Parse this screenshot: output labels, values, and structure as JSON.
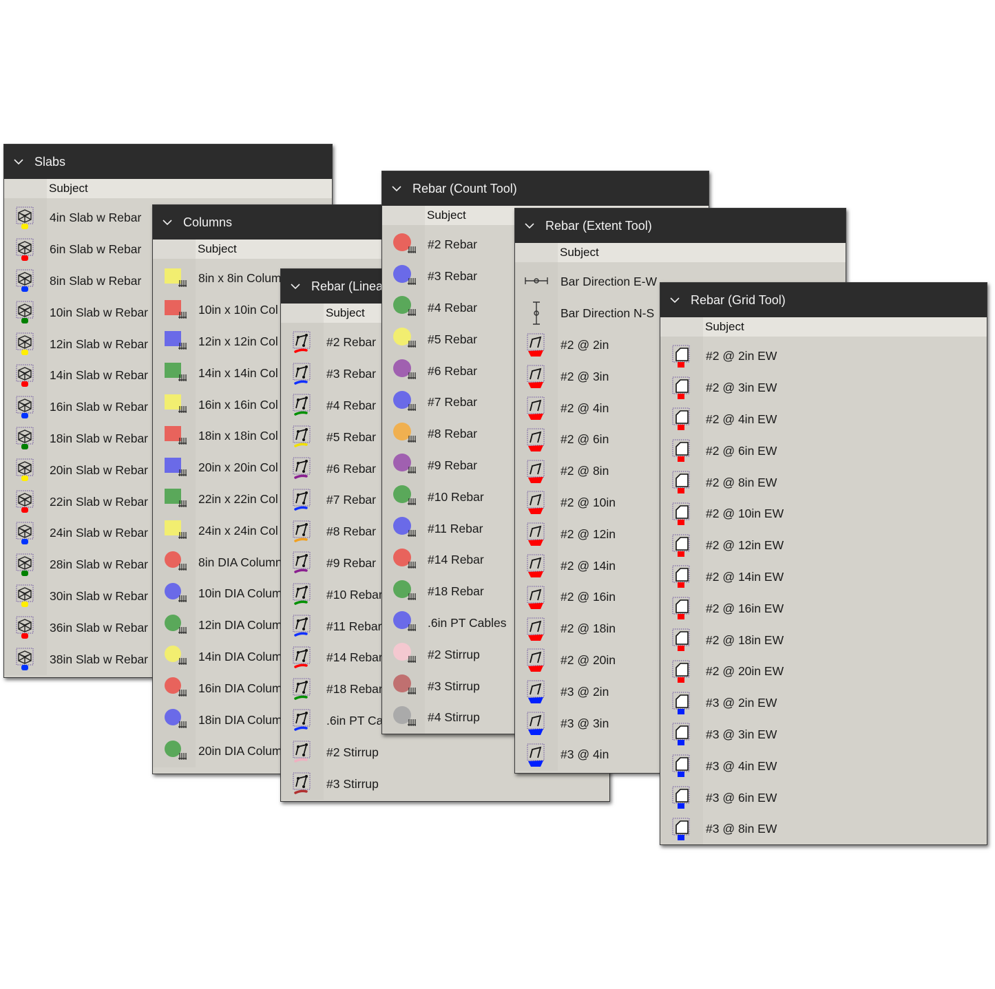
{
  "column_header": "Subject",
  "panels": {
    "slabs": {
      "title": "Slabs",
      "items": [
        {
          "label": "4in Slab w Rebar",
          "color": "#ffee00"
        },
        {
          "label": "6in Slab w Rebar",
          "color": "#ff0000"
        },
        {
          "label": "8in Slab w Rebar",
          "color": "#0033ff"
        },
        {
          "label": "10in Slab w Rebar",
          "color": "#008000"
        },
        {
          "label": "12in Slab w Rebar",
          "color": "#ffee00"
        },
        {
          "label": "14in Slab w Rebar",
          "color": "#ff0000"
        },
        {
          "label": "16in Slab w Rebar",
          "color": "#0033ff"
        },
        {
          "label": "18in Slab w Rebar",
          "color": "#008000"
        },
        {
          "label": "20in Slab w Rebar",
          "color": "#ffee00"
        },
        {
          "label": "22in Slab w Rebar",
          "color": "#ff0000"
        },
        {
          "label": "24in Slab w Rebar",
          "color": "#0033ff"
        },
        {
          "label": "28in Slab w Rebar",
          "color": "#008000"
        },
        {
          "label": "30in Slab w Rebar",
          "color": "#ffee00"
        },
        {
          "label": "36in Slab w Rebar",
          "color": "#ff0000"
        },
        {
          "label": "38in Slab w Rebar",
          "color": "#0033ff"
        }
      ]
    },
    "columns": {
      "title": "Columns",
      "items": [
        {
          "label": "8in x 8in Colum",
          "color": "#f2ee70",
          "shape": "square"
        },
        {
          "label": "10in x 10in Col",
          "color": "#e8635c",
          "shape": "square"
        },
        {
          "label": "12in x 12in Col",
          "color": "#6a6ae8",
          "shape": "square"
        },
        {
          "label": "14in x 14in Col",
          "color": "#5aa85a",
          "shape": "square"
        },
        {
          "label": "16in x 16in Col",
          "color": "#f2ee70",
          "shape": "square"
        },
        {
          "label": "18in x 18in Col",
          "color": "#e8635c",
          "shape": "square"
        },
        {
          "label": "20in x 20in Col",
          "color": "#6a6ae8",
          "shape": "square"
        },
        {
          "label": "22in x 22in Col",
          "color": "#5aa85a",
          "shape": "square"
        },
        {
          "label": "24in x 24in Col",
          "color": "#f2ee70",
          "shape": "square"
        },
        {
          "label": "8in DIA Column",
          "color": "#e8635c",
          "shape": "circle"
        },
        {
          "label": "10in DIA Colum",
          "color": "#6a6ae8",
          "shape": "circle"
        },
        {
          "label": "12in DIA Colum",
          "color": "#5aa85a",
          "shape": "circle"
        },
        {
          "label": "14in DIA Colum",
          "color": "#f2ee70",
          "shape": "circle"
        },
        {
          "label": "16in DIA Colum",
          "color": "#e8635c",
          "shape": "circle"
        },
        {
          "label": "18in DIA Colum",
          "color": "#6a6ae8",
          "shape": "circle"
        },
        {
          "label": "20in DIA Colum",
          "color": "#5aa85a",
          "shape": "circle"
        }
      ]
    },
    "rebar_linear": {
      "title": "Rebar (Linear",
      "items": [
        {
          "label": "#2 Rebar",
          "color": "#ff0000"
        },
        {
          "label": "#3 Rebar",
          "color": "#1030ff"
        },
        {
          "label": "#4 Rebar",
          "color": "#009000"
        },
        {
          "label": "#5 Rebar",
          "color": "#f0e000"
        },
        {
          "label": "#6 Rebar",
          "color": "#8a2090"
        },
        {
          "label": "#7 Rebar",
          "color": "#1030ff"
        },
        {
          "label": "#8 Rebar",
          "color": "#f0a020"
        },
        {
          "label": "#9 Rebar",
          "color": "#8a2090"
        },
        {
          "label": "#10 Rebar",
          "color": "#009000"
        },
        {
          "label": "#11 Rebar",
          "color": "#1030ff"
        },
        {
          "label": "#14 Rebar",
          "color": "#ff0000"
        },
        {
          "label": "#18 Rebar",
          "color": "#009000"
        },
        {
          "label": ".6in PT Ca",
          "color": "#1030ff"
        },
        {
          "label": "#2 Stirrup",
          "color": "#f0b0c0"
        },
        {
          "label": "#3 Stirrup",
          "color": "#b03030"
        }
      ]
    },
    "rebar_count": {
      "title": "Rebar (Count Tool)",
      "items": [
        {
          "label": "#2 Rebar",
          "color": "#e8635c"
        },
        {
          "label": "#3 Rebar",
          "color": "#6a6ae8"
        },
        {
          "label": "#4 Rebar",
          "color": "#5aa85a"
        },
        {
          "label": "#5 Rebar",
          "color": "#f2ee70"
        },
        {
          "label": "#6 Rebar",
          "color": "#a060b0"
        },
        {
          "label": "#7 Rebar",
          "color": "#6a6ae8"
        },
        {
          "label": "#8 Rebar",
          "color": "#f0b050"
        },
        {
          "label": "#9 Rebar",
          "color": "#a060b0"
        },
        {
          "label": "#10 Rebar",
          "color": "#5aa85a"
        },
        {
          "label": "#11 Rebar",
          "color": "#6a6ae8"
        },
        {
          "label": "#14 Rebar",
          "color": "#e8635c"
        },
        {
          "label": "#18 Rebar",
          "color": "#5aa85a"
        },
        {
          "label": ".6in PT Cables",
          "color": "#6a6ae8"
        },
        {
          "label": "#2 Stirrup",
          "color": "#f4c8d0"
        },
        {
          "label": "#3 Stirrup",
          "color": "#c07070"
        },
        {
          "label": "#4 Stirrup",
          "color": "#aaaaaa"
        }
      ]
    },
    "rebar_extent": {
      "title": "Rebar (Extent Tool)",
      "items": [
        {
          "label": "Bar Direction E-W",
          "kind": "ew"
        },
        {
          "label": "Bar Direction N-S",
          "kind": "ns"
        },
        {
          "label": "#2 @ 2in",
          "color": "#ff0000"
        },
        {
          "label": "#2 @ 3in",
          "color": "#ff0000"
        },
        {
          "label": "#2 @ 4in",
          "color": "#ff0000"
        },
        {
          "label": "#2 @ 6in",
          "color": "#ff0000"
        },
        {
          "label": "#2 @ 8in",
          "color": "#ff0000"
        },
        {
          "label": "#2 @ 10in",
          "color": "#ff0000"
        },
        {
          "label": "#2 @ 12in",
          "color": "#ff0000"
        },
        {
          "label": "#2 @ 14in",
          "color": "#ff0000"
        },
        {
          "label": "#2 @ 16in",
          "color": "#ff0000"
        },
        {
          "label": "#2 @ 18in",
          "color": "#ff0000"
        },
        {
          "label": "#2 @ 20in",
          "color": "#ff0000"
        },
        {
          "label": "#3 @ 2in",
          "color": "#0020ff"
        },
        {
          "label": "#3 @ 3in",
          "color": "#0020ff"
        },
        {
          "label": "#3 @ 4in",
          "color": "#0020ff"
        }
      ]
    },
    "rebar_grid": {
      "title": "Rebar (Grid Tool)",
      "items": [
        {
          "label": "#2 @ 2in EW",
          "color": "#ff0000"
        },
        {
          "label": "#2 @ 3in EW",
          "color": "#ff0000"
        },
        {
          "label": "#2 @ 4in EW",
          "color": "#ff0000"
        },
        {
          "label": "#2 @ 6in EW",
          "color": "#ff0000"
        },
        {
          "label": "#2 @ 8in EW",
          "color": "#ff0000"
        },
        {
          "label": "#2 @ 10in EW",
          "color": "#ff0000"
        },
        {
          "label": "#2 @ 12in EW",
          "color": "#ff0000"
        },
        {
          "label": "#2 @ 14in EW",
          "color": "#ff0000"
        },
        {
          "label": "#2 @ 16in EW",
          "color": "#ff0000"
        },
        {
          "label": "#2 @ 18in EW",
          "color": "#ff0000"
        },
        {
          "label": "#2 @ 20in EW",
          "color": "#ff0000"
        },
        {
          "label": "#3 @ 2in EW",
          "color": "#0020ff"
        },
        {
          "label": "#3 @ 3in EW",
          "color": "#0020ff"
        },
        {
          "label": "#3 @ 4in EW",
          "color": "#0020ff"
        },
        {
          "label": "#3 @ 6in EW",
          "color": "#0020ff"
        },
        {
          "label": "#3 @ 8in EW",
          "color": "#0020ff"
        }
      ]
    }
  }
}
